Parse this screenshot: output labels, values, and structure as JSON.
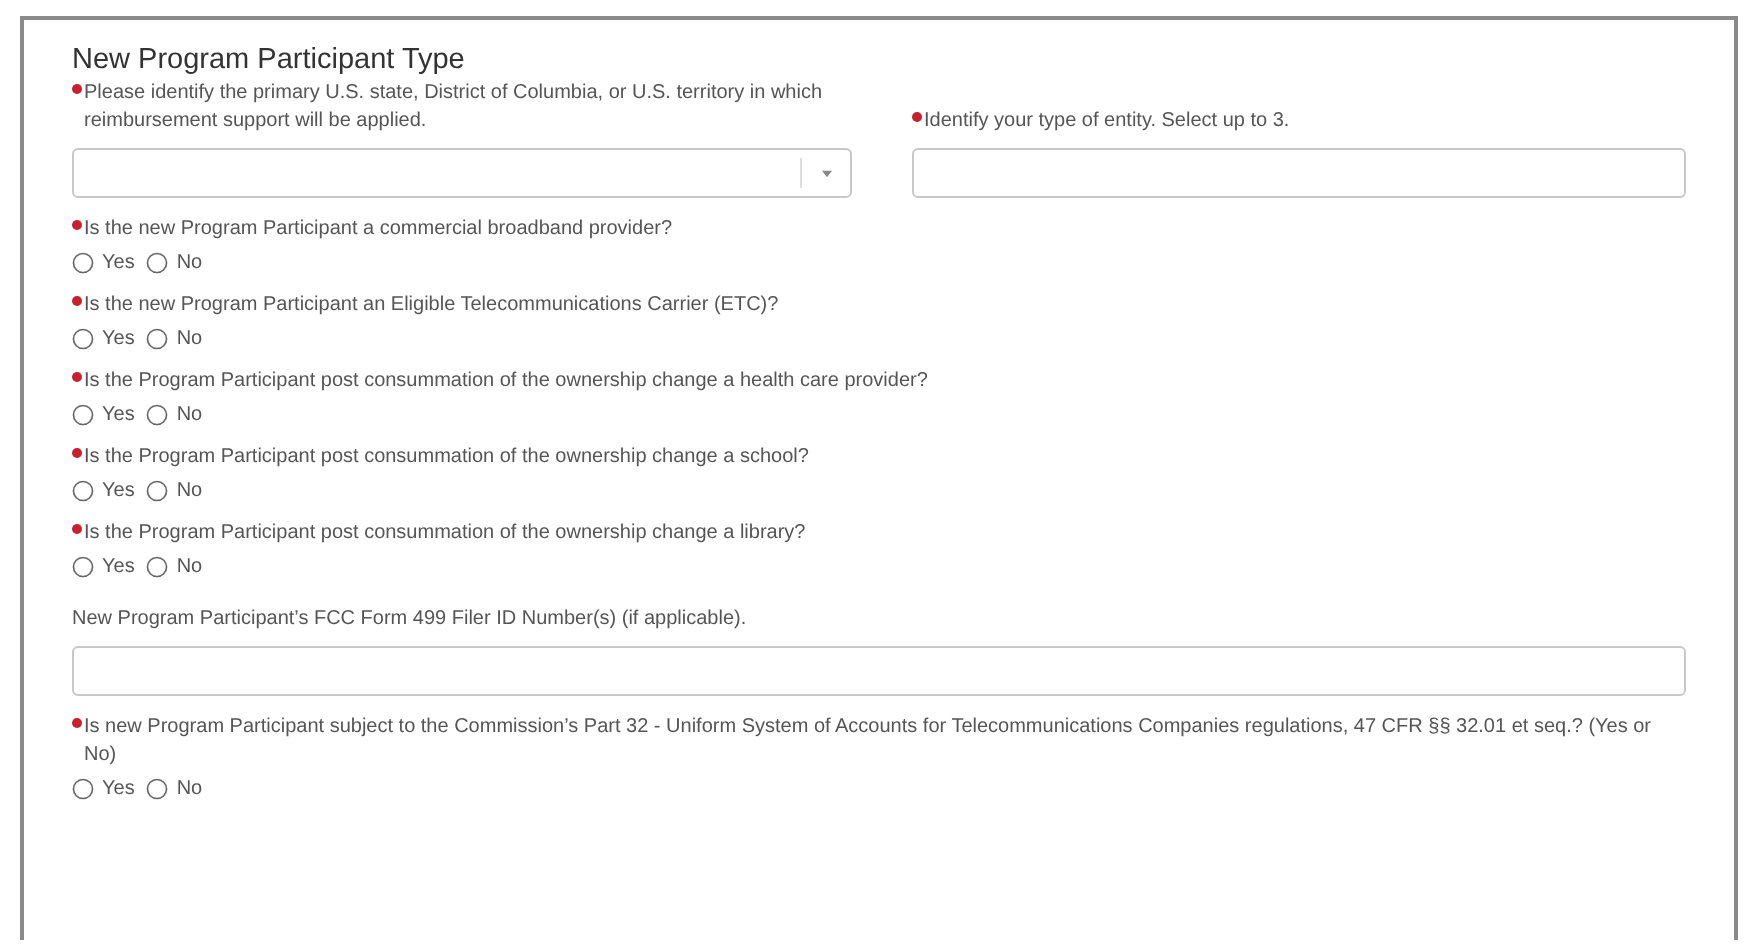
{
  "section": {
    "title": "New Program Participant Type"
  },
  "top_fields": [
    {
      "label": "Please identify the primary U.S. state, District of Columbia, or U.S. territory in which reimbursement support will be applied.",
      "required": true,
      "kind": "dropdown"
    },
    {
      "label": "Identify your type of entity. Select up to 3.",
      "required": true,
      "kind": "text"
    }
  ],
  "questions": [
    {
      "kind": "radio",
      "label": "Is the new Program Participant a commercial broadband provider?",
      "required": true,
      "options": [
        {
          "label": "Yes",
          "selected": false
        },
        {
          "label": "No",
          "selected": false
        }
      ]
    },
    {
      "kind": "radio",
      "label": "Is the new Program Participant an Eligible Telecommunications Carrier (ETC)?",
      "required": true,
      "options": [
        {
          "label": "Yes",
          "selected": false
        },
        {
          "label": "No",
          "selected": false
        }
      ]
    },
    {
      "kind": "radio",
      "label": "Is the Program Participant post consummation of the ownership change a health care provider?",
      "required": true,
      "options": [
        {
          "label": "Yes",
          "selected": false
        },
        {
          "label": "No",
          "selected": false
        }
      ]
    },
    {
      "kind": "radio",
      "label": "Is the Program Participant post consummation of the ownership change a school?",
      "required": true,
      "options": [
        {
          "label": "Yes",
          "selected": false
        },
        {
          "label": "No",
          "selected": false
        }
      ]
    },
    {
      "kind": "radio",
      "label": "Is the Program Participant post consummation of the ownership change a library?",
      "required": true,
      "options": [
        {
          "label": "Yes",
          "selected": false
        },
        {
          "label": "No",
          "selected": false
        }
      ]
    },
    {
      "kind": "text",
      "label": "New Program Participant’s FCC Form 499 Filer ID Number(s) (if applicable).",
      "required": false
    },
    {
      "kind": "radio",
      "label": "Is new Program Participant subject to the Commission’s Part 32 - Uniform System of Accounts for Telecommunications Companies regulations, 47 CFR §§ 32.01 et seq.? (Yes or No)",
      "required": true,
      "options": [
        {
          "label": "Yes",
          "selected": false
        },
        {
          "label": "No",
          "selected": false
        }
      ]
    }
  ]
}
